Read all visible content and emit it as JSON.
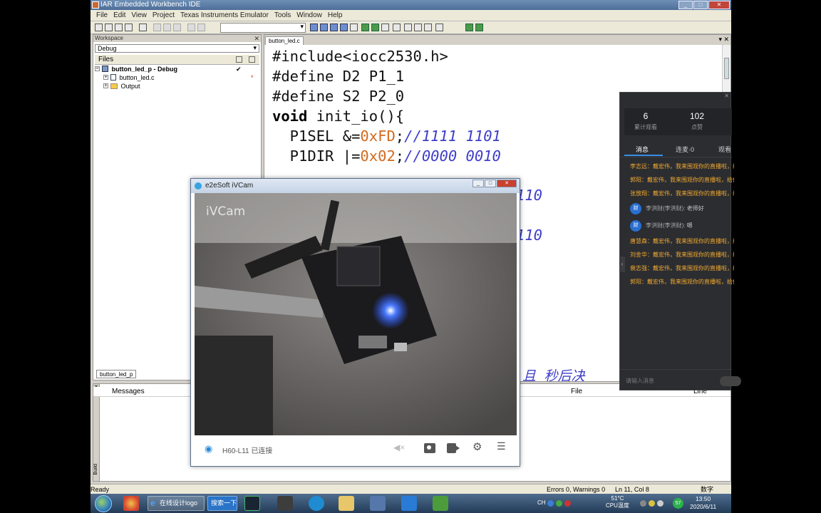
{
  "window": {
    "title": "IAR Embedded Workbench IDE"
  },
  "menu": [
    "File",
    "Edit",
    "View",
    "Project",
    "Texas Instruments Emulator",
    "Tools",
    "Window",
    "Help"
  ],
  "workspace": {
    "header": "Workspace",
    "config": "Debug",
    "files_header": "Files",
    "tree": [
      {
        "label": "button_led_p - Debug",
        "type": "project"
      },
      {
        "label": "button_led.c",
        "type": "file"
      },
      {
        "label": "Output",
        "type": "folder"
      }
    ],
    "tab": "button_led_p"
  },
  "editor": {
    "tab": "button_led.c",
    "lines": [
      {
        "pre": "#include<iocc2530.h>"
      },
      {
        "pre": "#define D2 P1_1"
      },
      {
        "pre": "#define S2 P2_0"
      },
      {
        "kw": "void",
        "rest": " init_io(){"
      },
      {
        "pre": "  P1SEL &=",
        "num": "0xFD",
        "rest": ";",
        "comment": "//1111 1101"
      },
      {
        "pre": "  P1DIR |=",
        "num": "0x02",
        "rest": ";",
        "comment": "//0000 0010"
      }
    ],
    "partial_1": "110",
    "partial_2": "110",
    "partial_3": "且  秒后决"
  },
  "messages": {
    "col_messages": "Messages",
    "col_file": "File",
    "col_line": "Line",
    "side_label": "Build"
  },
  "status": {
    "ready": "Ready",
    "errors": "Errors 0, Warnings 0",
    "position": "Ln 11, Col 8",
    "mode": "数字"
  },
  "ivcam": {
    "title": "e2eSoft iVCam",
    "watermark": "iVCam",
    "device_status": "H60-L11 已连接"
  },
  "live_panel": {
    "stats": [
      {
        "value": "6",
        "label": "累计观看"
      },
      {
        "value": "102",
        "label": "点赞"
      }
    ],
    "tabs": [
      "消息",
      "连麦·0",
      "观看"
    ],
    "chat": [
      {
        "kind": "system",
        "text": "李志远：戴宏伟，我来围观你的直播啦，给你点赞！"
      },
      {
        "kind": "system",
        "text": "郭阳：戴宏伟，我来围观你的直播啦，给你点赞！"
      },
      {
        "kind": "system",
        "text": "张放翔：戴宏伟，我来围观你的直播啦，给你点赞！"
      },
      {
        "kind": "user",
        "avatar": "财",
        "name": "李洪财(李洪财):",
        "text": "老师好"
      },
      {
        "kind": "user",
        "avatar": "财",
        "name": "李洪财(李洪财):",
        "text": "嗯"
      },
      {
        "kind": "system",
        "text": "唐慧森：戴宏伟，我来围观你的直播啦，给你点赞！"
      },
      {
        "kind": "system",
        "text": "刘金华：戴宏伟，我来围观你的直播啦，给你点赞！"
      },
      {
        "kind": "system",
        "text": "裴志强：戴宏伟，我来围观你的直播啦，给你点赞！"
      },
      {
        "kind": "system",
        "text": "郭阳：戴宏伟，我来围观你的直播啦，给你点赞！"
      }
    ],
    "input_placeholder": "请输入消息"
  },
  "taskbar": {
    "ie_label": "在线设计logo",
    "sogou_label": "搜索一下",
    "ime": "CH",
    "temp_value": "51°C",
    "temp_label": "CPU温度",
    "badge": "57",
    "time": "13:50",
    "date": "2020/6/11"
  }
}
